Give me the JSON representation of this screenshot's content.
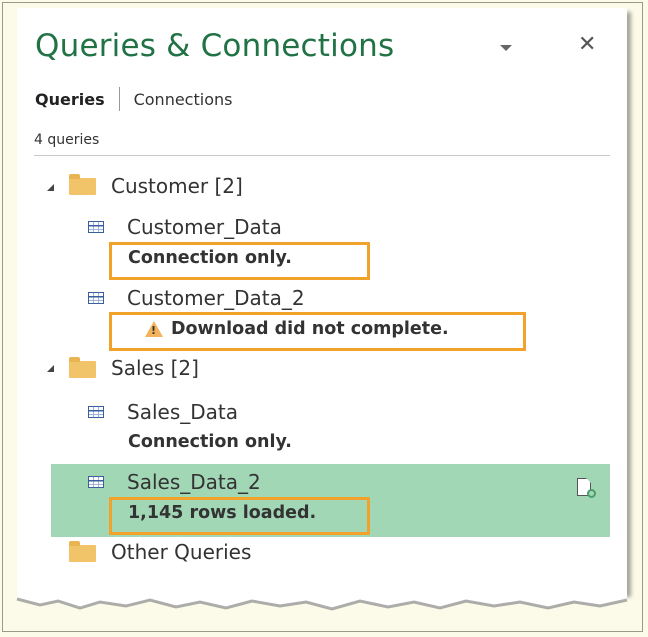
{
  "panel": {
    "title": "Queries & Connections",
    "tabs": [
      {
        "label": "Queries",
        "active": true
      },
      {
        "label": "Connections",
        "active": false
      }
    ],
    "query_count": "4 queries"
  },
  "groups": [
    {
      "label": "Customer [2]",
      "expanded": true,
      "queries": [
        {
          "name": "Customer_Data",
          "status": "Connection only.",
          "highlighted": true,
          "warning": false
        },
        {
          "name": "Customer_Data_2",
          "status": "Download did not complete.",
          "highlighted": true,
          "warning": true
        }
      ]
    },
    {
      "label": "Sales [2]",
      "expanded": true,
      "queries": [
        {
          "name": "Sales_Data",
          "status": "Connection only.",
          "highlighted": false,
          "warning": false
        },
        {
          "name": "Sales_Data_2",
          "status": "1,145 rows loaded.",
          "highlighted": true,
          "selected": true,
          "warning": false
        }
      ]
    },
    {
      "label": "Other Queries",
      "expanded": false,
      "queries": []
    }
  ],
  "icons": {
    "title_dropdown": "chevron-down-icon",
    "close": "close-icon",
    "group": "folder-icon",
    "query": "table-icon",
    "warning": "warning-icon",
    "refresh": "refresh-file-icon"
  },
  "colors": {
    "title": "#217346",
    "selected_row": "#a2d7b6",
    "highlight_box": "#f0a22a",
    "folder": "#f2c46a",
    "background": "#fcfbe9"
  }
}
